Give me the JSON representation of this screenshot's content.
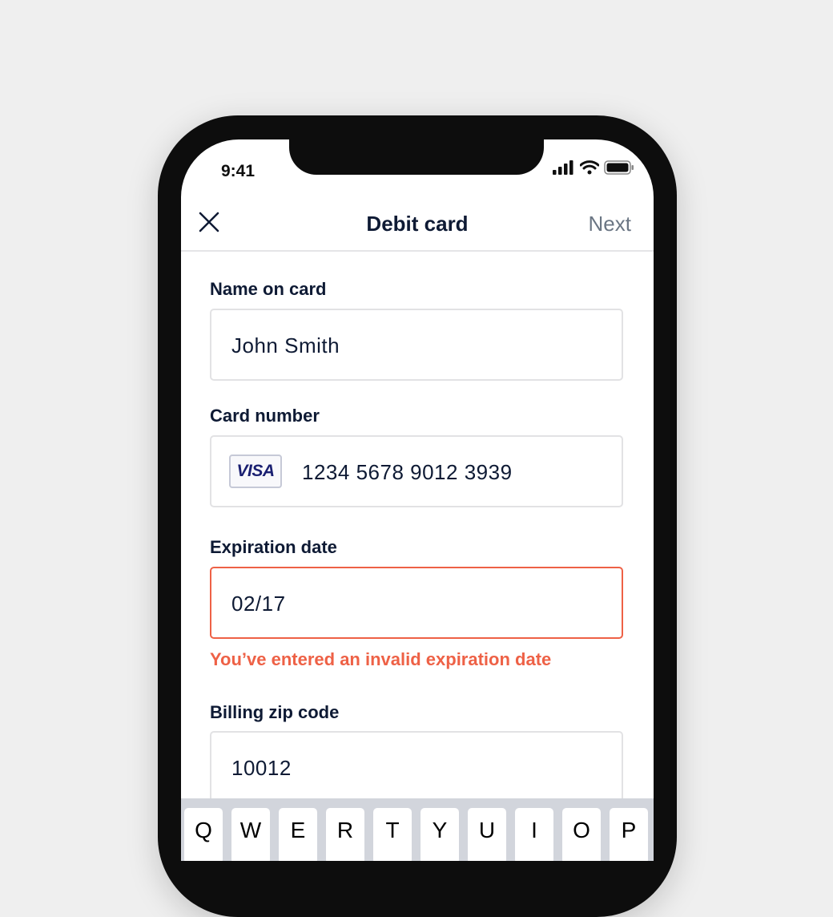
{
  "status_bar": {
    "time": "9:41",
    "icons": [
      "signal-icon",
      "wifi-icon",
      "battery-icon"
    ]
  },
  "nav": {
    "close_icon": "close-icon",
    "title": "Debit card",
    "next_label": "Next"
  },
  "form": {
    "name": {
      "label": "Name on card",
      "value": "John Smith"
    },
    "card_number": {
      "label": "Card number",
      "brand": "VISA",
      "value": "1234 5678 9012 3939"
    },
    "expiration": {
      "label": "Expiration date",
      "value": "02/17",
      "error": "You’ve entered an invalid expiration date"
    },
    "zip": {
      "label": "Billing zip code",
      "value": "10012"
    }
  },
  "keyboard": {
    "keys": [
      "Q",
      "W",
      "E",
      "R",
      "T",
      "Y",
      "U",
      "I",
      "O",
      "P"
    ]
  },
  "colors": {
    "background": "#efefef",
    "text_primary": "#0e1a34",
    "nav_next": "#6b7684",
    "error": "#ee6146",
    "visa_blue": "#1a1f71",
    "keyboard_bg": "#d2d5dc"
  }
}
